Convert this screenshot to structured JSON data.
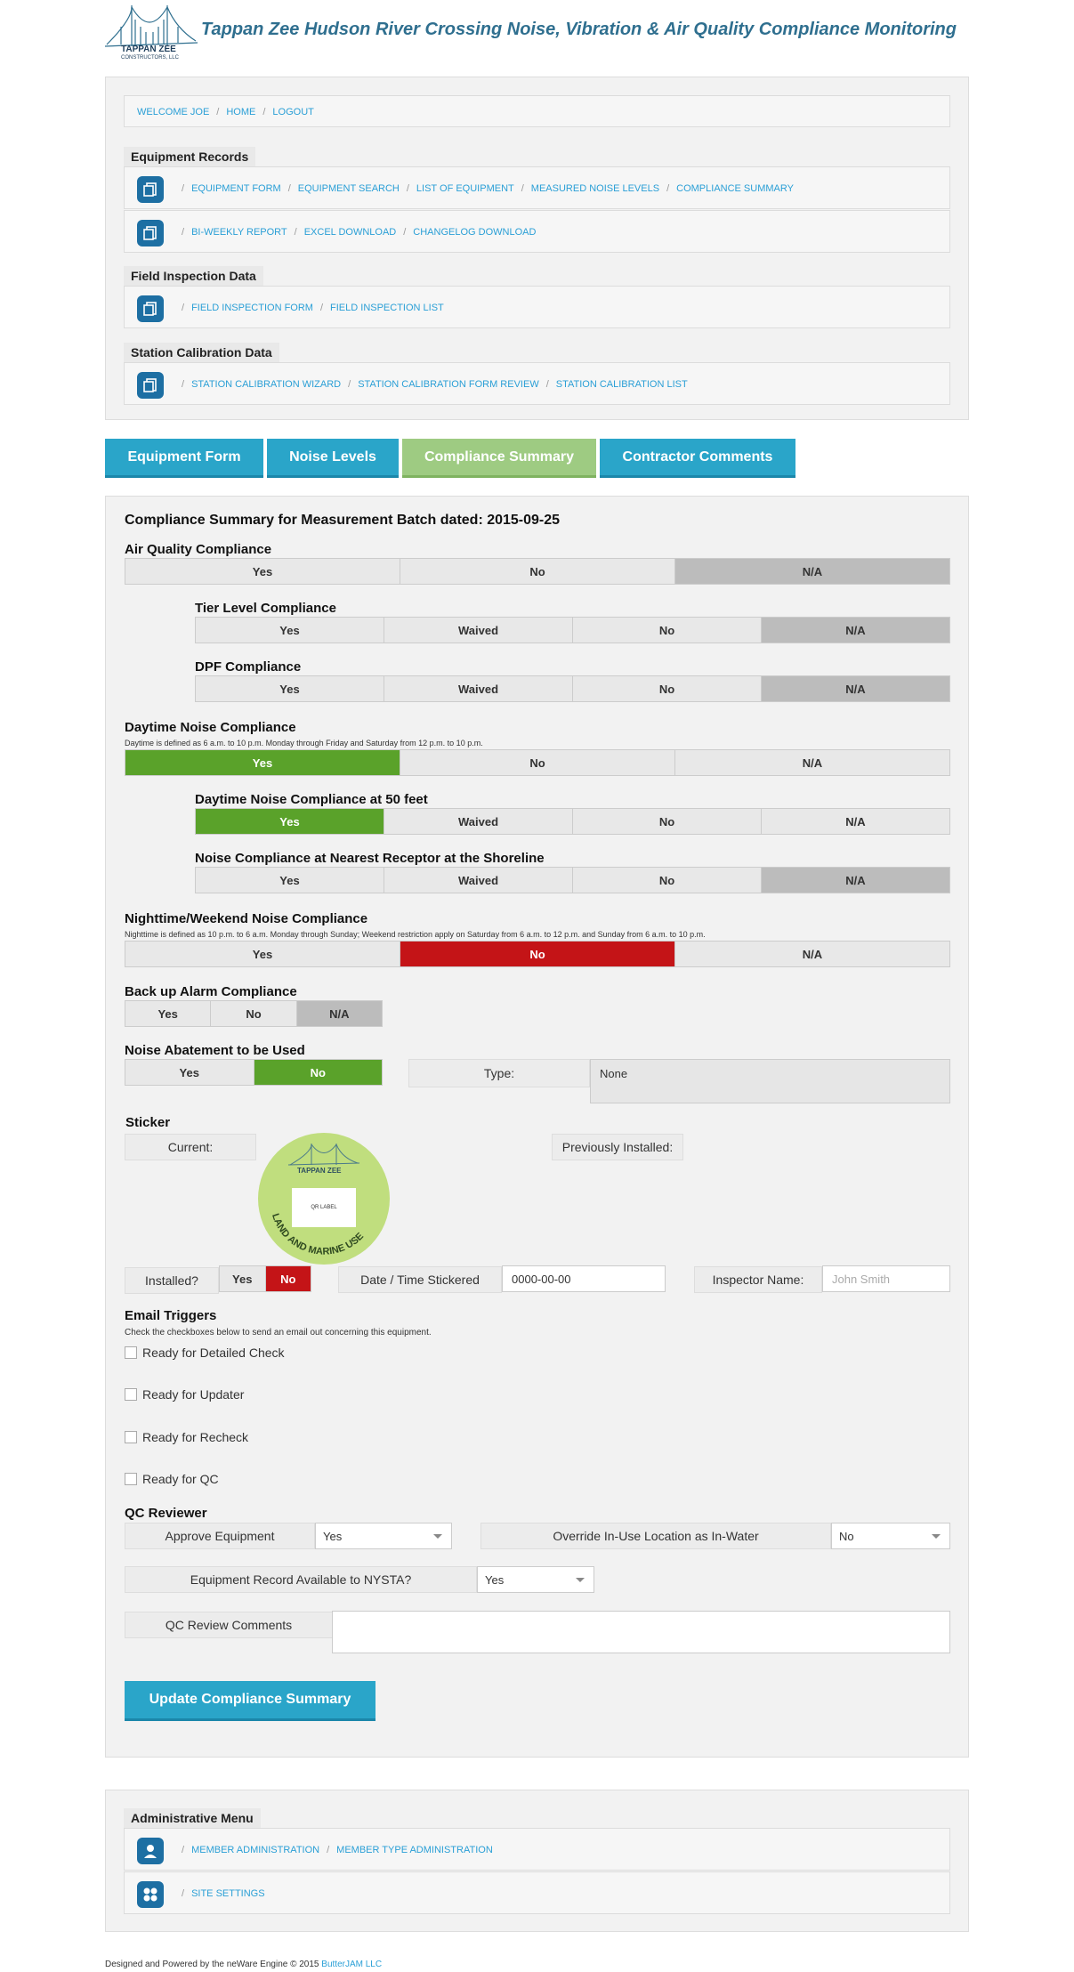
{
  "header": {
    "logo_text": "TAPPAN ZEE",
    "logo_subtext": "CONSTRUCTORS, LLC",
    "title": "Tappan Zee Hudson River Crossing Noise, Vibration & Air Quality Compliance Monitoring"
  },
  "topnav": {
    "links": [
      "WELCOME JOE",
      "HOME",
      "LOGOUT"
    ]
  },
  "sections": {
    "equipment_records": {
      "label": "Equipment Records",
      "row1": [
        "EQUIPMENT FORM",
        "EQUIPMENT SEARCH",
        "LIST OF EQUIPMENT",
        "MEASURED NOISE LEVELS",
        "COMPLIANCE SUMMARY"
      ],
      "row2": [
        "BI-WEEKLY REPORT",
        "EXCEL DOWNLOAD",
        "CHANGELOG DOWNLOAD"
      ]
    },
    "field_inspection": {
      "label": "Field Inspection Data",
      "row1": [
        "FIELD INSPECTION FORM",
        "FIELD INSPECTION LIST"
      ]
    },
    "station_calibration": {
      "label": "Station Calibration Data",
      "row1": [
        "STATION CALIBRATION WIZARD",
        "STATION CALIBRATION FORM REVIEW",
        "STATION CALIBRATION LIST"
      ]
    }
  },
  "tabs": [
    "Equipment Form",
    "Noise Levels",
    "Compliance Summary",
    "Contractor Comments"
  ],
  "summary": {
    "title": "Compliance Summary for Measurement Batch dated: 2015-09-25",
    "air_quality": {
      "label": "Air Quality Compliance",
      "options": [
        "Yes",
        "No",
        "N/A"
      ],
      "selected": "N/A"
    },
    "tier_level": {
      "label": "Tier Level Compliance",
      "options": [
        "Yes",
        "Waived",
        "No",
        "N/A"
      ],
      "selected": "N/A"
    },
    "dpf": {
      "label": "DPF Compliance",
      "options": [
        "Yes",
        "Waived",
        "No",
        "N/A"
      ],
      "selected": "N/A"
    },
    "daytime_noise": {
      "label": "Daytime Noise Compliance",
      "note": "Daytime is defined as 6 a.m. to 10 p.m. Monday through Friday and Saturday from 12 p.m. to 10 p.m.",
      "options": [
        "Yes",
        "No",
        "N/A"
      ],
      "selected": "Yes"
    },
    "daytime_50ft": {
      "label": "Daytime Noise Compliance at 50 feet",
      "options": [
        "Yes",
        "Waived",
        "No",
        "N/A"
      ],
      "selected": "Yes"
    },
    "nearest_receptor": {
      "label": "Noise Compliance at Nearest Receptor at the Shoreline",
      "options": [
        "Yes",
        "Waived",
        "No",
        "N/A"
      ],
      "selected": "N/A"
    },
    "nighttime_noise": {
      "label": "Nighttime/Weekend Noise Compliance",
      "note": "Nighttime is defined as 10 p.m. to 6 a.m. Monday through Sunday; Weekend restriction apply on Saturday from 6 a.m. to 12 p.m. and Sunday from 6 a.m. to 10 p.m.",
      "options": [
        "Yes",
        "No",
        "N/A"
      ],
      "selected": "No"
    },
    "backup_alarm": {
      "label": "Back up Alarm Compliance",
      "options": [
        "Yes",
        "No",
        "N/A"
      ],
      "selected": "N/A"
    },
    "noise_abatement": {
      "label": "Noise Abatement to be Used",
      "options": [
        "Yes",
        "No"
      ],
      "selected": "No",
      "type_label": "Type:",
      "type_value": "None"
    },
    "sticker": {
      "label": "Sticker",
      "current_label": "Current:",
      "previously_label": "Previously Installed:",
      "sticker_logo": "TAPPAN ZEE",
      "qr_label": "QR LABEL",
      "arc_text": "LAND AND MARINE USE"
    },
    "installed": {
      "label": "Installed?",
      "options": [
        "Yes",
        "No"
      ],
      "selected": "No"
    },
    "date_stickered": {
      "label": "Date / Time Stickered",
      "value": "0000-00-00"
    },
    "inspector": {
      "label": "Inspector Name:",
      "placeholder": "John Smith"
    },
    "email_triggers": {
      "label": "Email Triggers",
      "note": "Check the checkboxes below to send an email out concerning this equipment.",
      "items": [
        "Ready for Detailed Check",
        "Ready for Updater",
        "Ready for Recheck",
        "Ready for QC"
      ]
    },
    "qc": {
      "label": "QC Reviewer",
      "approve_label": "Approve Equipment",
      "approve_value": "Yes",
      "override_label": "Override In-Use Location as In-Water",
      "override_value": "No",
      "nysta_label": "Equipment Record Available to NYSTA?",
      "nysta_value": "Yes",
      "comments_label": "QC Review Comments",
      "comments_value": ""
    },
    "submit_label": "Update Compliance Summary"
  },
  "admin": {
    "label": "Administrative Menu",
    "row1": [
      "MEMBER ADMINISTRATION",
      "MEMBER TYPE ADMINISTRATION"
    ],
    "row2": [
      "SITE SETTINGS"
    ]
  },
  "footer": {
    "text": "Designed and Powered by the neWare Engine © 2015",
    "brand": "ButterJAM LLC"
  },
  "colors": {
    "accent": "#2aa5c9",
    "active_tab": "#9ecb82",
    "green": "#5aa22a",
    "red": "#c41417",
    "na_grey": "#bcbcbc",
    "link": "#2a9fd6"
  }
}
